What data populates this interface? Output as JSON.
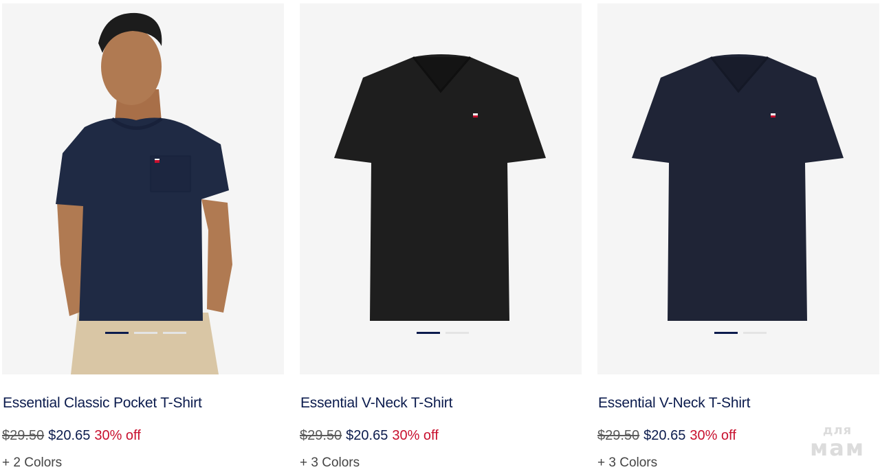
{
  "products": [
    {
      "name": "Essential Classic Pocket T-Shirt",
      "price_original": "$29.50",
      "price_sale": "$20.65",
      "discount": "30% off",
      "colors_label": "+ 2 Colors",
      "image_slides": 3,
      "active_slide": 1
    },
    {
      "name": "Essential V-Neck T-Shirt",
      "price_original": "$29.50",
      "price_sale": "$20.65",
      "discount": "30% off",
      "colors_label": "+ 3 Colors",
      "image_slides": 2,
      "active_slide": 1
    },
    {
      "name": "Essential V-Neck T-Shirt",
      "price_original": "$29.50",
      "price_sale": "$20.65",
      "discount": "30% off",
      "colors_label": "+ 3 Colors",
      "image_slides": 2,
      "active_slide": 1
    }
  ],
  "watermark": {
    "line1": "для",
    "line2": "мам"
  },
  "colors": {
    "brand_navy": "#0b1b4d",
    "sale_red": "#c8102e",
    "tile_bg": "#f5f5f5"
  }
}
